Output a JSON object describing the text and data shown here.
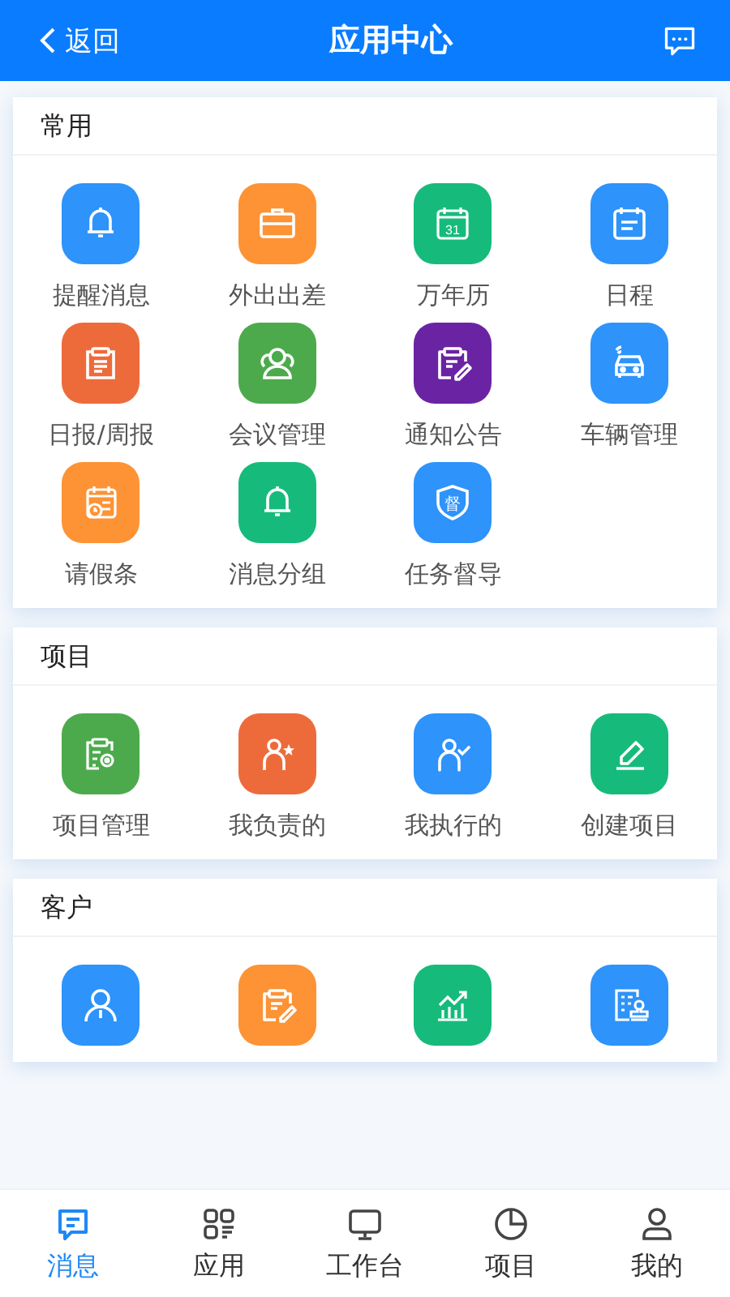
{
  "header": {
    "back": "返回",
    "title": "应用中心"
  },
  "sections": [
    {
      "title": "常用",
      "apps": [
        {
          "label": "提醒消息",
          "kind": "bell",
          "color": "#2e93fa"
        },
        {
          "label": "外出出差",
          "kind": "briefcase",
          "color": "#fd9334"
        },
        {
          "label": "万年历",
          "kind": "calendar",
          "color": "#16bb7c",
          "glyph_text": "31"
        },
        {
          "label": "日程",
          "kind": "schedule",
          "color": "#2e93fa"
        },
        {
          "label": "日报/周报",
          "kind": "report",
          "color": "#ed6b3a"
        },
        {
          "label": "会议管理",
          "kind": "people",
          "color": "#4caa4c"
        },
        {
          "label": "通知公告",
          "kind": "notice",
          "color": "#6a24a3"
        },
        {
          "label": "车辆管理",
          "kind": "car",
          "color": "#2e93fa"
        },
        {
          "label": "请假条",
          "kind": "leave",
          "color": "#fd9334"
        },
        {
          "label": "消息分组",
          "kind": "bell",
          "color": "#16bb7c"
        },
        {
          "label": "任务督导",
          "kind": "shield",
          "color": "#2e93fa",
          "glyph_text": "督"
        }
      ]
    },
    {
      "title": "项目",
      "apps": [
        {
          "label": "项目管理",
          "kind": "project",
          "color": "#4caa4c"
        },
        {
          "label": "我负责的",
          "kind": "person-star",
          "color": "#ed6b3a"
        },
        {
          "label": "我执行的",
          "kind": "person-check",
          "color": "#2e93fa"
        },
        {
          "label": "创建项目",
          "kind": "pen",
          "color": "#16bb7c"
        }
      ]
    },
    {
      "title": "客户",
      "apps": [
        {
          "kind": "person",
          "color": "#2e93fa"
        },
        {
          "kind": "notice",
          "color": "#fd9334"
        },
        {
          "kind": "chart",
          "color": "#16bb7c"
        },
        {
          "kind": "stamp",
          "color": "#2e93fa"
        }
      ]
    }
  ],
  "tabs": [
    {
      "label": "消息",
      "kind": "chat",
      "selected": true
    },
    {
      "label": "应用",
      "kind": "grid",
      "selected": false
    },
    {
      "label": "工作台",
      "kind": "monitor",
      "selected": false
    },
    {
      "label": "项目",
      "kind": "pie",
      "selected": false
    },
    {
      "label": "我的",
      "kind": "user",
      "selected": false
    }
  ]
}
